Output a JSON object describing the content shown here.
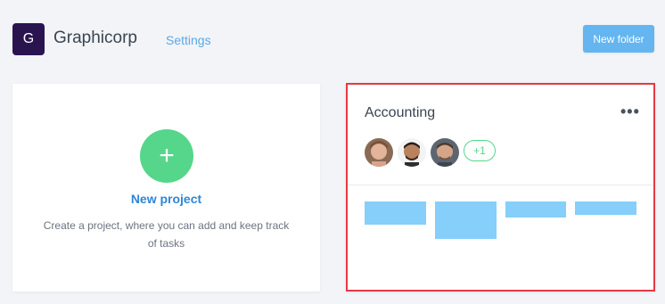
{
  "header": {
    "workspace_initial": "G",
    "workspace_name": "Graphicorp",
    "settings_label": "Settings",
    "new_folder_label": "New folder"
  },
  "new_project": {
    "plus": "+",
    "title": "New project",
    "description": "Create a project, where you can add and keep track of tasks"
  },
  "project_card": {
    "title": "Accounting",
    "more": "•••",
    "members": [
      "member-1",
      "member-2",
      "member-3"
    ],
    "extra_members": "+1"
  },
  "colors": {
    "accent": "#64b5f0",
    "green": "#55d68a",
    "highlight_border": "#e53945",
    "bar": "#85cffa"
  }
}
